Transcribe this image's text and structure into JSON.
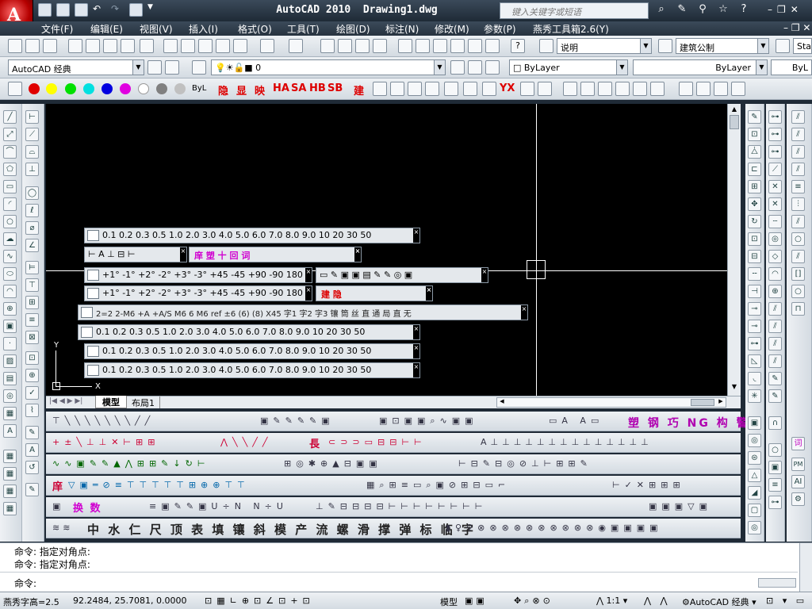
{
  "title": {
    "app_name": "AutoCAD 2010",
    "file_name": "Drawing1.dwg",
    "search_placeholder": "键入关键字或短语"
  },
  "menus": [
    "文件(F)",
    "编辑(E)",
    "视图(V)",
    "插入(I)",
    "格式(O)",
    "工具(T)",
    "绘图(D)",
    "标注(N)",
    "修改(M)",
    "参数(P)",
    "燕秀工具箱2.6(Y)"
  ],
  "toolbar": {
    "text_style": "说明",
    "dim_style": "建筑公制",
    "table_style": "Sta",
    "workspace": "AutoCAD 经典",
    "layer": "0",
    "color": "ByLayer",
    "linetype": "ByLayer",
    "lineweight": "ByL",
    "color_label": "ByL",
    "yanxiu_row1": [
      "隐",
      "显",
      "映",
      "HA",
      "SA",
      "HB",
      "SB",
      "建",
      "YX"
    ]
  },
  "floating_toolbars": [
    {
      "icon": "slope-icon",
      "text": "0.1  0.2  0.3  0.5  1.0  2.0  3.0  4.0  5.0  6.0  7.0  8.0  9.0  10  20  30  50"
    },
    {
      "icon": "dim-icon",
      "text": "庠  塑  十  回  词"
    },
    {
      "icon": "rotate-icon",
      "text": "+1°  -1°  +2°  -2°  +3°  -3°  +45  -45  +90  -90  180"
    },
    {
      "icon": "mirror-icon",
      "text": "+1°  -1°  +2°  -2°  +3°  -3°  +45  -45  +90  -90  180"
    },
    {
      "icon": "dim-text-icon",
      "text": "2=2  2-M6  +A  +A/S  M6  6  M6  ref  ±6  (6)  (8)  X45  字1  字2  字3  镶  筒  丝  直  通  局  直  无"
    },
    {
      "icon": "line-icon",
      "text": "0.1  0.2  0.3  0.5  1.0  2.0  3.0  4.0  5.0  6.0  7.0  8.0  9.0  10  20  30  50"
    },
    {
      "icon": "slope-icon",
      "text": "0.1  0.2  0.3  0.5  1.0  2.0  3.0  4.0  5.0  6.0  7.0  8.0  9.0  10  20  30  50"
    },
    {
      "icon": "hatch-icon",
      "text": "0.1  0.2  0.3  0.5  1.0  2.0  3.0  4.0  5.0  6.0  7.0  8.0  9.0  10  20  30  50"
    },
    {
      "icon": "file-icon",
      "text": ""
    },
    {
      "icon": "build-icon",
      "text": "建  隐"
    }
  ],
  "tabs": {
    "model": "模型",
    "layout": "布局1"
  },
  "ucs": {
    "x": "X",
    "y": "Y"
  },
  "bottom_toolbars": {
    "row1": "塑 钢 巧 NG 构 警",
    "row2": "長",
    "row5": "换  数",
    "row6": "中 水 仁 尺 顶 表 填 镶 斜 模 产 流 螺 滑 撑 弹 标 临 字"
  },
  "command": {
    "history": [
      "命令: 指定对角点:",
      "命令: 指定对角点:"
    ],
    "prompt": "命令:"
  },
  "status": {
    "text_height": "燕秀字高=2.5",
    "coords": "92.2484,  25.7081, 0.0000",
    "model": "模型",
    "annotation_scale": "1:1",
    "workspace": "AutoCAD 经典"
  }
}
